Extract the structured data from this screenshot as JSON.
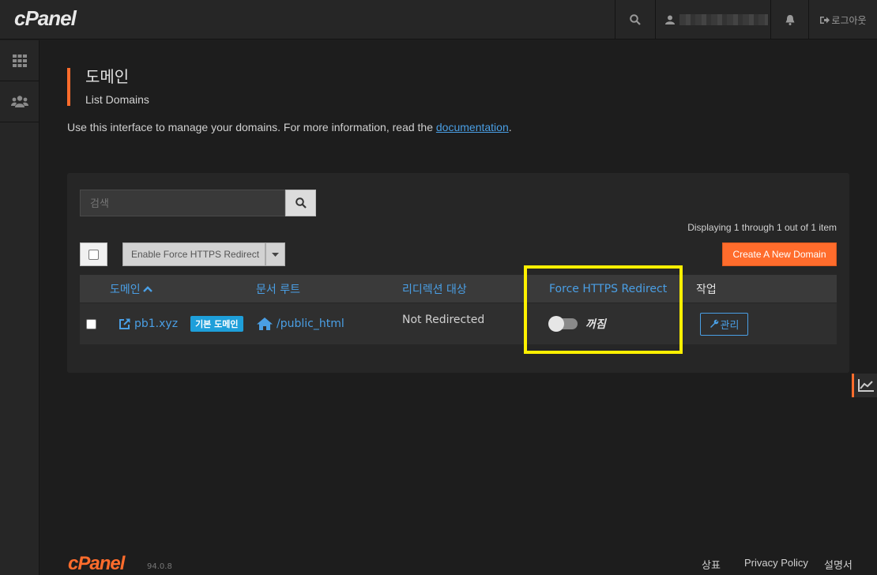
{
  "app": {
    "logo": "cPanel",
    "logout_label": "로그아웃"
  },
  "page": {
    "title": "도메인",
    "subtitle": "List Domains",
    "intro_text": "Use this interface to manage your domains. For more information, read the ",
    "intro_link": "documentation",
    "intro_end": "."
  },
  "toolbar": {
    "search_placeholder": "검색",
    "display_count": "Displaying 1 through 1 out of 1 item",
    "bulk_action_label": "Enable Force HTTPS Redirect",
    "create_label": "Create A New Domain"
  },
  "table": {
    "columns": [
      "도메인",
      "문서 루트",
      "리디렉션 대상",
      "Force HTTPS Redirect",
      "작업"
    ],
    "rows": [
      {
        "domain": "pb1.xyz",
        "badge": "기본 도메인",
        "docroot": "/public_html",
        "redirect": "Not Redirected",
        "https_state": "꺼짐",
        "https_on": false,
        "action": "관리"
      }
    ]
  },
  "footer": {
    "logo": "cPanel",
    "version": "94.0.8",
    "links": [
      "상표",
      "Privacy Policy",
      "설명서"
    ]
  },
  "colors": {
    "accent": "#ff6c2c",
    "link": "#4a9fe5",
    "badge": "#1e9fda",
    "highlight": "#fff000"
  }
}
